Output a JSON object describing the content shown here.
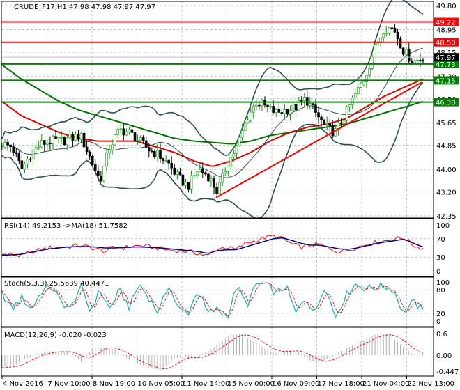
{
  "header": {
    "symbol_info": "CRUDE_F17,H1  47.98 47.98 47.97 47.97"
  },
  "chart_data": [
    {
      "type": "line",
      "title": "CRUDE_F17,H1",
      "ohlc_last": {
        "open": 47.98,
        "high": 47.98,
        "low": 47.97,
        "close": 47.97
      },
      "ylim": [
        42.35,
        49.8
      ],
      "y_ticks": [
        "49.80",
        "48.95",
        "48.15",
        "47.30",
        "46.50",
        "45.65",
        "44.85",
        "44.00",
        "43.20",
        "42.35"
      ],
      "x_ticks": [
        "4 Nov 2016",
        "7 Nov 10:00",
        "8 Nov 19:00",
        "10 Nov 05:00",
        "11 Nov 14:00",
        "15 Nov 00:00",
        "16 Nov 09:00",
        "17 Nov 18:00",
        "21 Nov 04:00",
        "22 Nov 13:00"
      ],
      "price_path": [
        44.9,
        44.8,
        44.0,
        44.6,
        44.9,
        45.0,
        45.0,
        45.1,
        45.2,
        44.4,
        43.6,
        44.8,
        45.4,
        45.3,
        45.0,
        44.7,
        44.5,
        44.2,
        43.7,
        43.4,
        44.0,
        43.8,
        43.2,
        44.2,
        44.8,
        45.8,
        46.4,
        46.2,
        46.0,
        46.1,
        46.2,
        46.5,
        46.0,
        45.5,
        45.3,
        45.9,
        46.6,
        47.2,
        48.2,
        49.0,
        49.0,
        48.2,
        47.8,
        47.97
      ],
      "ma_slow": [
        47.7,
        47.2,
        46.8,
        46.4,
        46.1,
        45.9,
        45.7,
        45.5,
        45.3,
        45.1,
        45.0,
        44.95,
        44.9,
        45.0,
        45.2,
        45.3,
        45.4,
        45.5,
        45.6,
        45.8,
        46.0,
        46.2,
        46.4
      ],
      "ma_fast": [
        46.4,
        45.9,
        45.6,
        45.3,
        45.1,
        45.0,
        45.0,
        45.0,
        44.8,
        44.6,
        44.3,
        44.1,
        44.3,
        44.6,
        45.0,
        45.3,
        45.5,
        45.6,
        45.8,
        46.2,
        46.6,
        46.9,
        47.2
      ],
      "trendline": {
        "from": 43.0,
        "to": 47.08
      },
      "levels": [
        {
          "label": "49.22",
          "value": 49.22,
          "color": "#ff0000"
        },
        {
          "label": "48.50",
          "value": 48.5,
          "color": "#ff0000"
        },
        {
          "label": "47.73",
          "value": 47.73,
          "color": "#008000"
        },
        {
          "label": "47.15",
          "value": 47.15,
          "color": "#008000"
        },
        {
          "label": "46.38",
          "value": 46.38,
          "color": "#008000"
        }
      ],
      "current_price": {
        "label": "47.97",
        "value": 47.97
      }
    },
    {
      "type": "line",
      "title": "RSI(14) 49.2153  ->MA(18) 51.7582",
      "ylim": [
        0,
        100
      ],
      "y_ticks": [
        "100",
        "70",
        "30",
        "0"
      ],
      "rsi": [
        35,
        36,
        33,
        40,
        45,
        50,
        52,
        52,
        55,
        53,
        48,
        42,
        52,
        50,
        54,
        55,
        52,
        48,
        45,
        44,
        42,
        38,
        32,
        48,
        52,
        46,
        60,
        65,
        72,
        76,
        70,
        58,
        52,
        55,
        58,
        48,
        42,
        46,
        52,
        58,
        62,
        66,
        70,
        72,
        55,
        49
      ],
      "ma": [
        34,
        35,
        36,
        40,
        44,
        48,
        50,
        52,
        53,
        53,
        52,
        50,
        50,
        51,
        52,
        52,
        51,
        50,
        48,
        46,
        44,
        42,
        38,
        44,
        46,
        46,
        52,
        58,
        64,
        70,
        72,
        66,
        60,
        56,
        56,
        52,
        48,
        47,
        50,
        55,
        60,
        63,
        66,
        69,
        60,
        52
      ]
    },
    {
      "type": "line",
      "title": "Stoch(5,3,3) 25.5639 40.4471",
      "ylim": [
        0,
        100
      ],
      "y_ticks": [
        "100",
        "80",
        "20",
        "0"
      ],
      "k": [
        70,
        30,
        60,
        30,
        75,
        90,
        50,
        30,
        90,
        25,
        80,
        30,
        80,
        35,
        95,
        60,
        20,
        95,
        30,
        20,
        80,
        20,
        30,
        10,
        90,
        40,
        95,
        95,
        70,
        90,
        20,
        60,
        20,
        95,
        10,
        60,
        95,
        85,
        85,
        90,
        80,
        20,
        50,
        25
      ]
    },
    {
      "type": "bar",
      "title": "MACD(12,26,9) -0.020 -0.023",
      "ylim": [
        -0.447,
        0.6
      ],
      "y_ticks": [
        "0.6",
        "0.00",
        "-0.447"
      ],
      "histogram": [
        -0.35,
        -0.3,
        -0.1,
        0.02,
        0.1,
        0.1,
        0.08,
        -0.2,
        0.2,
        0.22,
        0.15,
        -0.1,
        -0.25,
        -0.35,
        -0.45,
        -0.1,
        -0.05,
        -0.1,
        0.1,
        0.3,
        0.55,
        0.6,
        0.4,
        0.2,
        0.05,
        0.15,
        0.1,
        -0.15,
        -0.2,
        -0.05,
        0.15,
        0.3,
        0.45,
        0.6,
        0.55,
        0.3,
        0.05,
        -0.02
      ]
    }
  ]
}
